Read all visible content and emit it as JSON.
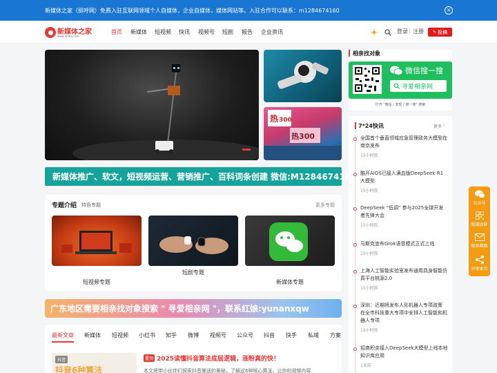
{
  "topbar": {
    "notice": "新媒体之家（挺呼网）免费入驻互联网领域个人自媒体，企业自媒体，媒体网站等。入驻合作可以联系：m1284674160",
    "close_icon": "close-circle-icon"
  },
  "logo": {
    "title": "新媒体之家",
    "subtitle": "www.ihuha.com",
    "brand_color": "#e53935"
  },
  "nav": {
    "items": [
      "首页",
      "新媒体",
      "短视频",
      "快讯",
      "视频号",
      "短剧",
      "报告",
      "企业资讯"
    ],
    "active_index": 0,
    "active_color": "#e53935"
  },
  "header_right": {
    "theme_icon": "sun-icon",
    "search_icon": "search-icon",
    "login": "登录",
    "separator": "|",
    "register": "注册",
    "post_button": "投稿",
    "post_icon": "pen-icon"
  },
  "hero": {
    "main_image": "robot-stage-image",
    "side_images": [
      "robot-arm-image",
      "crowd-300-image"
    ]
  },
  "banner1": {
    "text": "新媒体推广、软文，短视频运营、营销推广、百科词条创建  微信:M1284674160",
    "color": "#16a39b"
  },
  "topics": {
    "title": "专题介绍",
    "subtitle": "特色专题",
    "more": "更多专题",
    "items": [
      {
        "caption": "短视频专题",
        "image": "laptop-video-image"
      },
      {
        "caption": "短剧专题",
        "image": "hands-dice-image"
      },
      {
        "caption": "新媒体专题",
        "image": "wechat-logo-image"
      }
    ]
  },
  "banner2": {
    "text": "广东地区需要相亲找对象搜索 \" 寻爱相亲网 \"，联系红娘:yunanxqw"
  },
  "article_tabs": {
    "items": [
      "最新文章",
      "新媒体",
      "短视频",
      "小红书",
      "知乎",
      "微博",
      "视频号",
      "公众号",
      "抖音",
      "快手",
      "私域",
      "方案"
    ],
    "active_index": 0
  },
  "article_preview": {
    "tag": "抖音",
    "thumb_text": "抖音6种算法",
    "badge": "置顶",
    "title": "2025读懂抖音算法底层逻辑，涨粉真的快！",
    "excerpt": "本文将带小伙伴们探索抖音推送的奥秘，了解这6种核心算法，让你的视频内容"
  },
  "sidebar_ad": {
    "title": "相亲找对象",
    "wechat_label": "微信搜一搜",
    "search_text": "寻爱相亲网",
    "hint": "打开 \"微信 / 发现 / 搜一搜\" 搜索",
    "ad_color": "#1fbf5f"
  },
  "flash": {
    "title": "7*24快讯",
    "more": "更多",
    "items": [
      {
        "title": "全国首个垂直领域应急管理政务大模型在南京发布",
        "time": "15小时前"
      },
      {
        "title": "酷开AIOS已接入满血版DeepSeek-R1大模型",
        "time": "15小时前"
      },
      {
        "title": "DeepSeek \"低调\" 参与2025全球开发者先锋大会",
        "time": "15小时前"
      },
      {
        "title": "马斯克宣布Grok语音模式正式上线",
        "time": "15小时前"
      },
      {
        "title": "上海人工智能实验室发布通用具身智能仿真平台桃源2.0",
        "time": "15小时前"
      },
      {
        "title": "深圳：近期将发布人形机器人专项政策 在全市科技重大专项中安排人工智能和机器人专项",
        "time": "15小时前"
      },
      {
        "title": "招商积余接入DeepSeek大模型上线本地知识库应用",
        "time": "1天前"
      }
    ]
  },
  "float_bar": {
    "color": "#f39c12",
    "items": [
      {
        "label": "公众号",
        "icon": "wechat-icon"
      },
      {
        "label": "新媒体群",
        "icon": "qrcode-icon"
      },
      {
        "label": "联系邮箱",
        "icon": "mail-icon"
      },
      {
        "label": "分享本页",
        "icon": "share-icon"
      }
    ]
  }
}
